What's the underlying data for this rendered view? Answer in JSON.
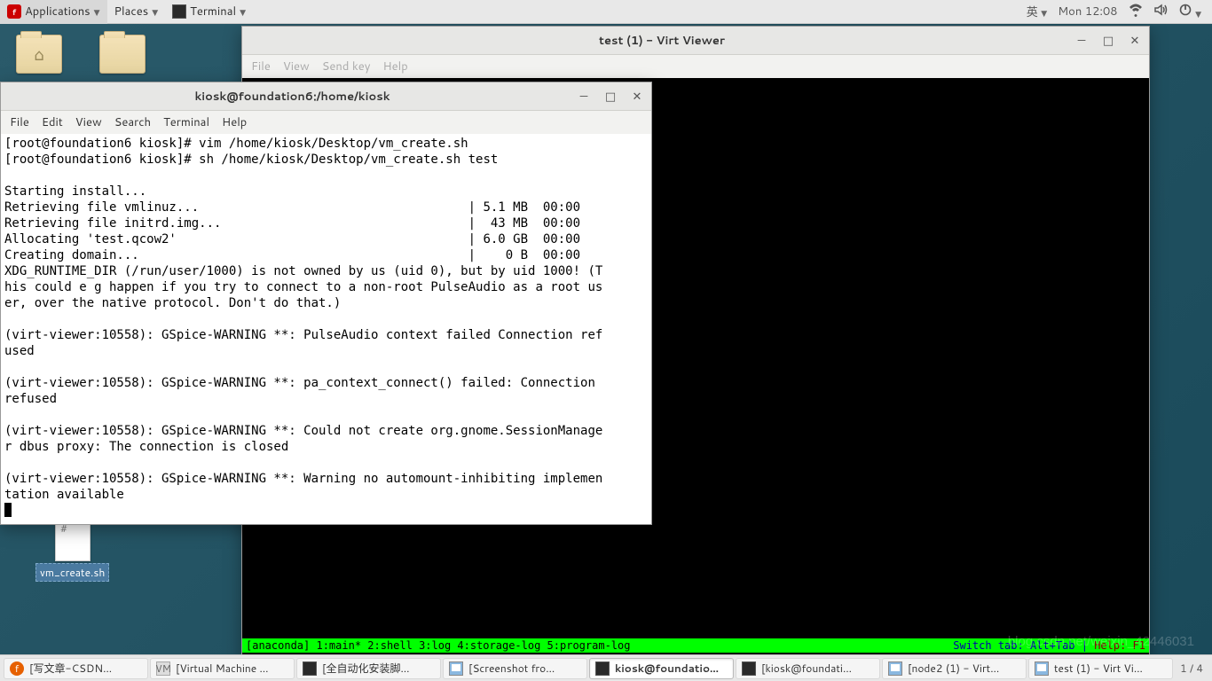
{
  "panel": {
    "applications": "Applications",
    "places": "Places",
    "terminal": "Terminal",
    "ime": "英",
    "clock": "Mon 12:08"
  },
  "desktop": {
    "home_label": "",
    "folder_label": "",
    "file_label": "vm_create.sh"
  },
  "virt": {
    "title": "test (1) - Virt Viewer",
    "menu": {
      "file": "File",
      "view": "View",
      "sendkey": "Send key",
      "help": "Help"
    },
    "anaconda_left": "[anaconda] 1:main* 2:shell  3:log  4:storage-log  5:program-log",
    "anaconda_right_a": "Switch tab: Alt+Tab | ",
    "anaconda_right_b": "Help: F1"
  },
  "term": {
    "title": "kiosk@foundation6:/home/kiosk",
    "menu": {
      "file": "File",
      "edit": "Edit",
      "view": "View",
      "search": "Search",
      "terminal": "Terminal",
      "help": "Help"
    },
    "content": "[root@foundation6 kiosk]# vim /home/kiosk/Desktop/vm_create.sh\n[root@foundation6 kiosk]# sh /home/kiosk/Desktop/vm_create.sh test\n\nStarting install...\nRetrieving file vmlinuz...                                    | 5.1 MB  00:00\nRetrieving file initrd.img...                                 |  43 MB  00:00\nAllocating 'test.qcow2'                                       | 6.0 GB  00:00\nCreating domain...                                            |    0 B  00:00\nXDG_RUNTIME_DIR (/run/user/1000) is not owned by us (uid 0), but by uid 1000! (T\nhis could e g happen if you try to connect to a non-root PulseAudio as a root us\ner, over the native protocol. Don't do that.)\n\n(virt-viewer:10558): GSpice-WARNING **: PulseAudio context failed Connection ref\nused\n\n(virt-viewer:10558): GSpice-WARNING **: pa_context_connect() failed: Connection \nrefused\n\n(virt-viewer:10558): GSpice-WARNING **: Could not create org.gnome.SessionManage\nr dbus proxy: The connection is closed\n\n(virt-viewer:10558): GSpice-WARNING **: Warning no automount-inhibiting implemen\ntation available\n"
  },
  "taskbar": {
    "items": [
      {
        "label": "[写文章-CSDN…",
        "icon": "firefox"
      },
      {
        "label": "[Virtual Machine …",
        "icon": "vmm"
      },
      {
        "label": "[全自动化安装脚…",
        "icon": "terminal"
      },
      {
        "label": "[Screenshot fro…",
        "icon": "image"
      },
      {
        "label": "kiosk@foundatio…",
        "icon": "terminal",
        "active": true
      },
      {
        "label": "[kiosk@foundati…",
        "icon": "terminal"
      },
      {
        "label": "[node2 (1) - Virt…",
        "icon": "monitor"
      },
      {
        "label": "test (1) - Virt Vi…",
        "icon": "monitor"
      }
    ],
    "tray": "1 / 4"
  },
  "watermark": "blog.csdn.net/weixin_42446031"
}
